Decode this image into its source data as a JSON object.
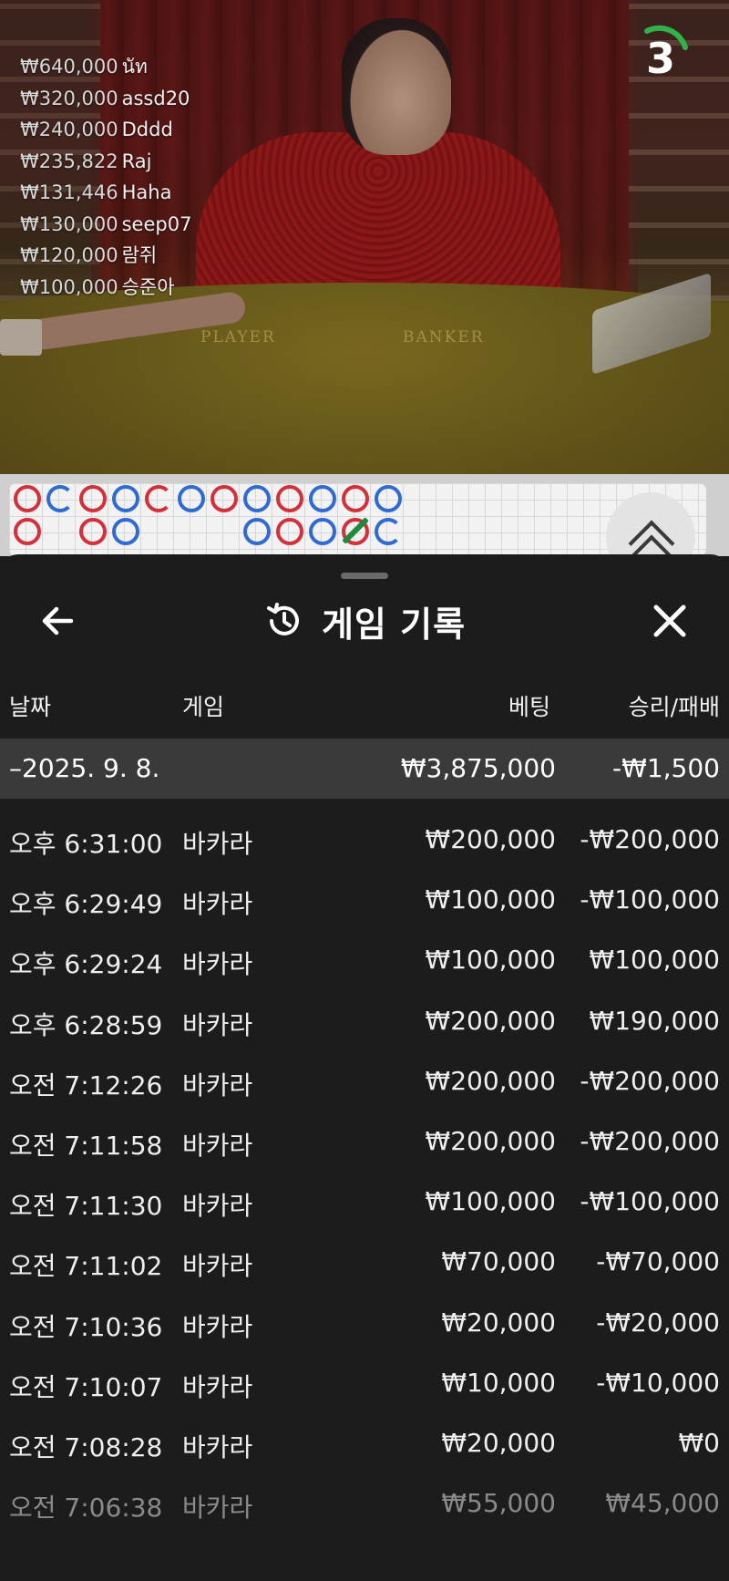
{
  "leaderboard": [
    {
      "amount": "₩640,000",
      "name": "นัท"
    },
    {
      "amount": "₩320,000",
      "name": "assd20"
    },
    {
      "amount": "₩240,000",
      "name": "Dddd"
    },
    {
      "amount": "₩235,822",
      "name": "Raj"
    },
    {
      "amount": "₩131,446",
      "name": "Haha"
    },
    {
      "amount": "₩130,000",
      "name": "seep07"
    },
    {
      "amount": "₩120,000",
      "name": "람쥐"
    },
    {
      "amount": "₩100,000",
      "name": "승준아"
    }
  ],
  "timer": {
    "value": "3",
    "color": "#2fb24a"
  },
  "table_labels": {
    "player": "PLAYER",
    "banker": "BANKER"
  },
  "colors": {
    "player": "#2f6bd3",
    "banker": "#d3303a",
    "tie": "#1d8a3c",
    "panel": "#1c1c1c"
  },
  "panel": {
    "title": "게임 기록",
    "icons": {
      "back": "arrow-left-icon",
      "history": "history-icon",
      "close": "close-icon"
    },
    "columns": {
      "date": "날짜",
      "game": "게임",
      "bet": "베팅",
      "result": "승리/패배"
    },
    "date_group": {
      "date": "–2025. 9. 8.",
      "bet_total": "₩3,875,000",
      "result_total": "-₩1,500"
    },
    "rows": [
      {
        "time": "오후 6:31:00",
        "game": "바카라",
        "bet": "₩200,000",
        "result": "-₩200,000"
      },
      {
        "time": "오후 6:29:49",
        "game": "바카라",
        "bet": "₩100,000",
        "result": "-₩100,000"
      },
      {
        "time": "오후 6:29:24",
        "game": "바카라",
        "bet": "₩100,000",
        "result": "₩100,000"
      },
      {
        "time": "오후 6:28:59",
        "game": "바카라",
        "bet": "₩200,000",
        "result": "₩190,000"
      },
      {
        "time": "오전 7:12:26",
        "game": "바카라",
        "bet": "₩200,000",
        "result": "-₩200,000"
      },
      {
        "time": "오전 7:11:58",
        "game": "바카라",
        "bet": "₩200,000",
        "result": "-₩200,000"
      },
      {
        "time": "오전 7:11:30",
        "game": "바카라",
        "bet": "₩100,000",
        "result": "-₩100,000"
      },
      {
        "time": "오전 7:11:02",
        "game": "바카라",
        "bet": "₩70,000",
        "result": "-₩70,000"
      },
      {
        "time": "오전 7:10:36",
        "game": "바카라",
        "bet": "₩20,000",
        "result": "-₩20,000"
      },
      {
        "time": "오전 7:10:07",
        "game": "바카라",
        "bet": "₩10,000",
        "result": "-₩10,000"
      },
      {
        "time": "오전 7:08:28",
        "game": "바카라",
        "bet": "₩20,000",
        "result": "₩0"
      },
      {
        "time": "오전 7:06:38",
        "game": "바카라",
        "bet": "₩55,000",
        "result": "₩45,000"
      }
    ]
  }
}
